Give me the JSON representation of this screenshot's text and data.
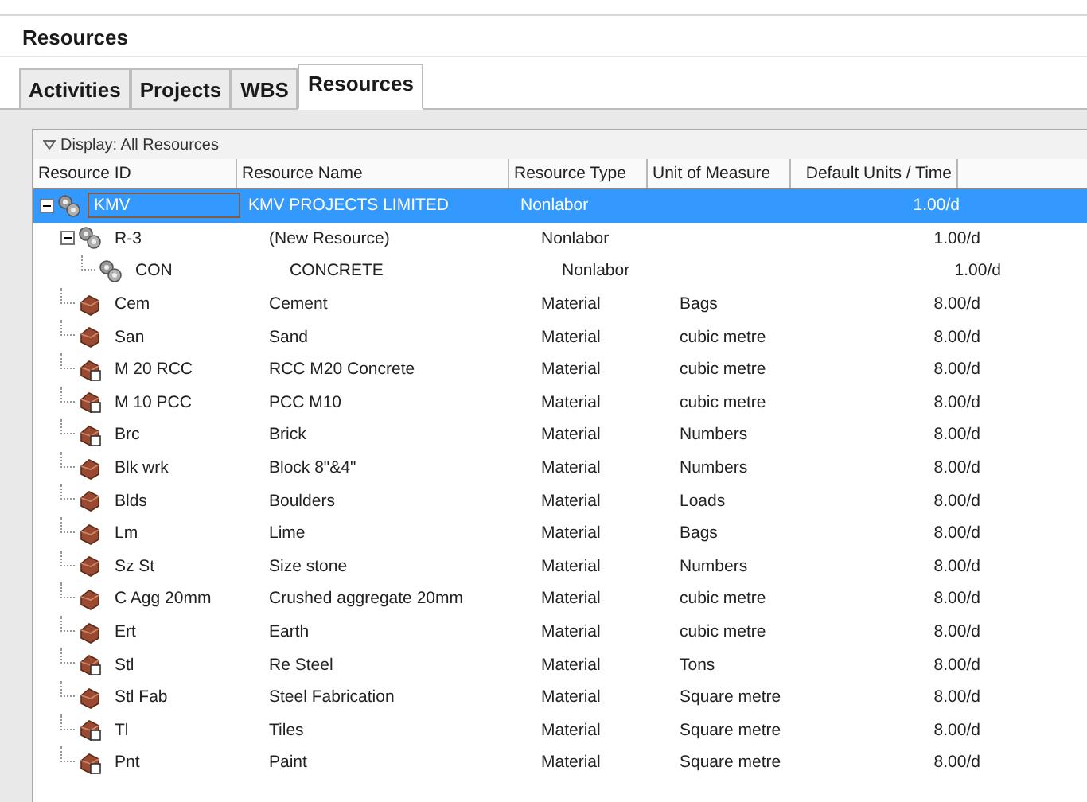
{
  "window": {
    "title": "Resources"
  },
  "tabs": [
    {
      "label": "Activities",
      "selected": false
    },
    {
      "label": "Projects",
      "selected": false
    },
    {
      "label": "WBS",
      "selected": false
    },
    {
      "label": "Resources",
      "selected": true
    }
  ],
  "filter": {
    "label": "Display: All Resources"
  },
  "table": {
    "columns": [
      "Resource ID",
      "Resource Name",
      "Resource Type",
      "Unit of Measure",
      "Default Units / Time"
    ],
    "rows": [
      {
        "id": "KMV",
        "name": "KMV PROJECTS LIMITED",
        "type": "Nonlabor",
        "units_time": "1.00/d",
        "kind": "nonlabor",
        "selected": true,
        "expanded": true,
        "children": [
          {
            "id": "R-3",
            "name": "(New Resource)",
            "type": "Nonlabor",
            "units_time": "1.00/d",
            "kind": "nonlabor",
            "selected": false,
            "expanded": true,
            "children": [
              {
                "id": "CON",
                "name": "CONCRETE",
                "type": "Nonlabor",
                "units_time": "1.00/d",
                "kind": "nonlabor",
                "selected": false
              }
            ]
          },
          {
            "id": "Cem",
            "name": "Cement",
            "type": "Material",
            "unit": "Bags",
            "units_time": "8.00/d",
            "kind": "material",
            "selected": false
          },
          {
            "id": "San",
            "name": "Sand",
            "type": "Material",
            "unit": "cubic metre",
            "units_time": "8.00/d",
            "kind": "material",
            "selected": false
          },
          {
            "id": "M 20 RCC",
            "name": "RCC M20 Concrete",
            "type": "Material",
            "unit": "cubic metre",
            "units_time": "8.00/d",
            "kind": "tagged",
            "selected": false
          },
          {
            "id": "M 10 PCC",
            "name": "PCC M10",
            "type": "Material",
            "unit": "cubic metre",
            "units_time": "8.00/d",
            "kind": "tagged",
            "selected": false
          },
          {
            "id": "Brc",
            "name": "Brick",
            "type": "Material",
            "unit": "Numbers",
            "units_time": "8.00/d",
            "kind": "tagged",
            "selected": false
          },
          {
            "id": "Blk wrk",
            "name": "Block 8\"&4\"",
            "type": "Material",
            "unit": "Numbers",
            "units_time": "8.00/d",
            "kind": "material",
            "selected": false
          },
          {
            "id": "Blds",
            "name": "Boulders",
            "type": "Material",
            "unit": "Loads",
            "units_time": "8.00/d",
            "kind": "material",
            "selected": false
          },
          {
            "id": "Lm",
            "name": "Lime",
            "type": "Material",
            "unit": "Bags",
            "units_time": "8.00/d",
            "kind": "material",
            "selected": false
          },
          {
            "id": "Sz St",
            "name": "Size stone",
            "type": "Material",
            "unit": "Numbers",
            "units_time": "8.00/d",
            "kind": "material",
            "selected": false
          },
          {
            "id": "C Agg 20mm",
            "name": "Crushed aggregate 20mm",
            "type": "Material",
            "unit": "cubic metre",
            "units_time": "8.00/d",
            "kind": "material",
            "selected": false
          },
          {
            "id": "Ert",
            "name": "Earth",
            "type": "Material",
            "unit": "cubic metre",
            "units_time": "8.00/d",
            "kind": "material",
            "selected": false
          },
          {
            "id": "Stl",
            "name": "Re Steel",
            "type": "Material",
            "unit": "Tons",
            "units_time": "8.00/d",
            "kind": "tagged",
            "selected": false
          },
          {
            "id": "Stl Fab",
            "name": "Steel Fabrication",
            "type": "Material",
            "unit": "Square metre",
            "units_time": "8.00/d",
            "kind": "material",
            "selected": false
          },
          {
            "id": "Tl",
            "name": "Tiles",
            "type": "Material",
            "unit": "Square metre",
            "units_time": "8.00/d",
            "kind": "tagged",
            "selected": false
          },
          {
            "id": "Pnt",
            "name": "Paint",
            "type": "Material",
            "unit": "Square metre",
            "units_time": "8.00/d",
            "kind": "tagged",
            "selected": false
          }
        ]
      }
    ]
  }
}
